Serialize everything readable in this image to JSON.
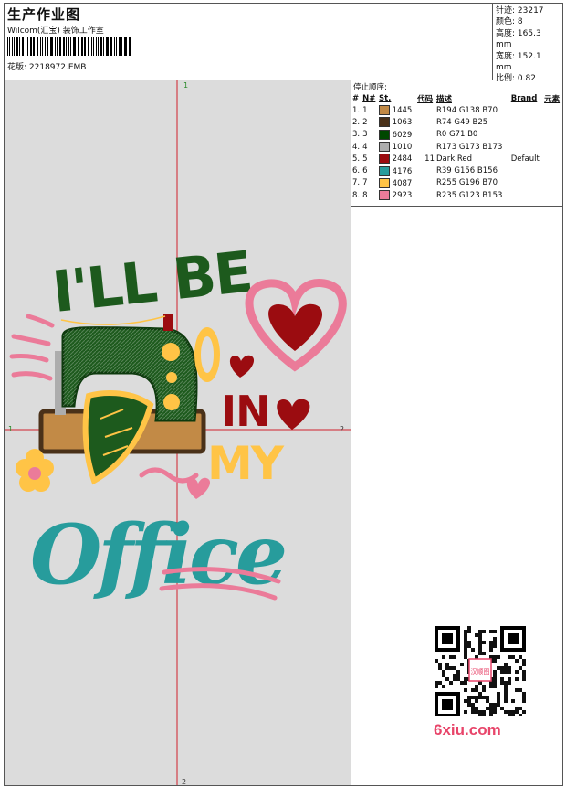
{
  "header": {
    "title": "生产作业图",
    "subtitle": "Wilcom(汇宝) 装饰工作室",
    "filename": "花版: 2218972.EMB"
  },
  "stats": [
    {
      "label": "针迹",
      "value": "23217"
    },
    {
      "label": "颜色",
      "value": "8"
    },
    {
      "label": "高度",
      "value": "165.3 mm"
    },
    {
      "label": "宽度",
      "value": "152.1 mm"
    },
    {
      "label": "比例",
      "value": "0.82"
    }
  ],
  "sequence": {
    "title": "停止顺序:",
    "columns": [
      "#",
      "N#",
      "St.",
      "代码",
      "描述",
      "Brand",
      "元素"
    ],
    "rows": [
      {
        "n": "1.",
        "num": "1",
        "color": "#c28a46",
        "st": "1445",
        "code": "",
        "desc": "R194 G138 B70",
        "brand": ""
      },
      {
        "n": "2.",
        "num": "2",
        "color": "#4a3119",
        "st": "1063",
        "code": "",
        "desc": "R74 G49 B25",
        "brand": ""
      },
      {
        "n": "3.",
        "num": "3",
        "color": "#004700",
        "st": "6029",
        "code": "",
        "desc": "R0 G71 B0",
        "brand": ""
      },
      {
        "n": "4.",
        "num": "4",
        "color": "#adadad",
        "st": "1010",
        "code": "",
        "desc": "R173 G173 B173",
        "brand": ""
      },
      {
        "n": "5.",
        "num": "5",
        "color": "#9b0c10",
        "st": "2484",
        "code": "11",
        "desc": "Dark Red",
        "brand": "Default"
      },
      {
        "n": "6.",
        "num": "6",
        "color": "#279c9c",
        "st": "4176",
        "code": "",
        "desc": "R39 G156 B156",
        "brand": ""
      },
      {
        "n": "7.",
        "num": "7",
        "color": "#ffc446",
        "st": "4087",
        "code": "",
        "desc": "R255 G196 B70",
        "brand": ""
      },
      {
        "n": "8.",
        "num": "8",
        "color": "#eb7b99",
        "st": "2923",
        "code": "",
        "desc": "R235 G123 B153",
        "brand": ""
      }
    ]
  },
  "artwork": {
    "line1": "I'LL BE",
    "line2": "IN",
    "line3": "MY",
    "line4": "Office",
    "marker_top": "1",
    "marker_bottom": "2",
    "marker_left": "1",
    "marker_right": "2"
  },
  "qr": {
    "stamp": "汉顺图",
    "brand": "6xiu.com"
  }
}
